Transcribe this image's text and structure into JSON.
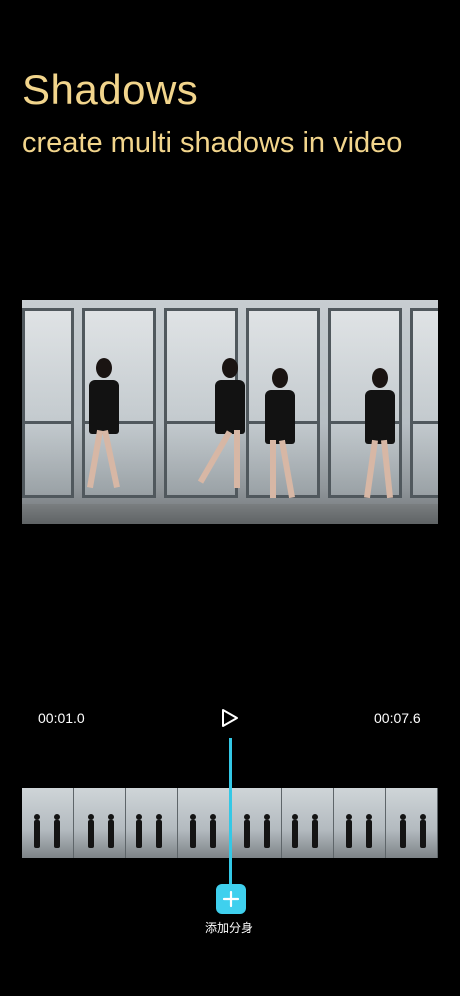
{
  "header": {
    "title": "Shadows",
    "subtitle": "create multi shadows in video"
  },
  "timeline": {
    "start_time": "00:01.0",
    "end_time": "00:07.6",
    "play_icon": "play-icon"
  },
  "actions": {
    "add_label": "添加分身",
    "add_icon": "plus-icon"
  },
  "colors": {
    "accent": "#3fd0ee",
    "title": "#f2d58c",
    "background": "#000000"
  }
}
